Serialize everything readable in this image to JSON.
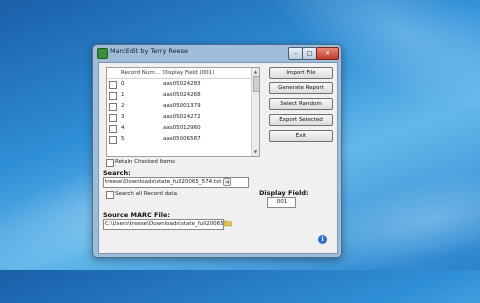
{
  "window": {
    "title": "MarcEdit by Terry Reese",
    "minimize_symbol": "–",
    "maximize_symbol": "□",
    "close_symbol": "✕"
  },
  "list": {
    "columns": [
      "Record Num...",
      "Display Field (001)"
    ],
    "rows": [
      {
        "num": "0",
        "field": "aas05024283"
      },
      {
        "num": "1",
        "field": "aas05024268"
      },
      {
        "num": "2",
        "field": "aas05001379"
      },
      {
        "num": "3",
        "field": "aas05024272"
      },
      {
        "num": "4",
        "field": "aas05012960"
      },
      {
        "num": "5",
        "field": "aas05006587"
      }
    ]
  },
  "buttons": {
    "import": "Import File",
    "generate": "Generate Report",
    "select_random": "Select Random",
    "export_selected": "Export Selected",
    "exit": "Exit"
  },
  "retain_checked": "Retain Checked Items",
  "search": {
    "label": "Search:",
    "value": "treese\\Downloads\\state_full20065_574.txt",
    "search_all_label": "Search all Record data"
  },
  "display_field": {
    "label": "Display Field:",
    "value": "001"
  },
  "source": {
    "label": "Source MARC File:",
    "value": "C:\\Users\\treese\\Downloads\\state_full20065"
  },
  "colors": {
    "desktop": "#2f8fd6",
    "window_frame": "#9fbcd9",
    "client": "#f0f0f0",
    "info": "#2e6fd0"
  },
  "icons": [
    "app-icon",
    "search-go-icon",
    "folder-open-icon",
    "info-icon"
  ]
}
